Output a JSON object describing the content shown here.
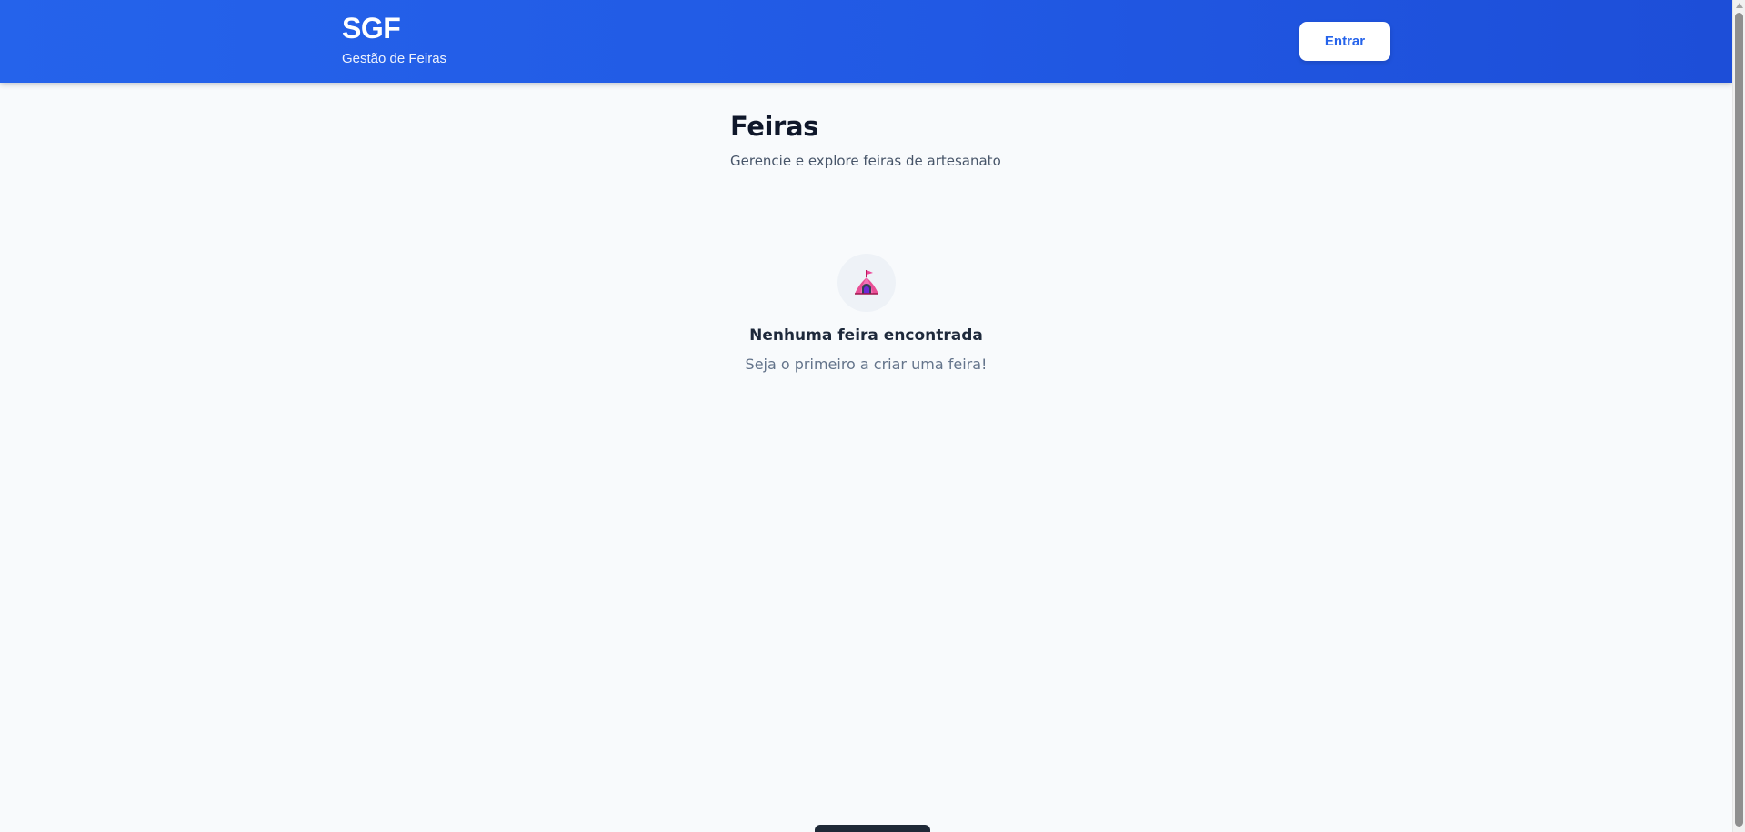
{
  "header": {
    "brand_title": "SGF",
    "brand_subtitle": "Gestão de Feiras",
    "login_label": "Entrar"
  },
  "main": {
    "title": "Feiras",
    "subtitle": "Gerencie e explore feiras de artesanato"
  },
  "empty_state": {
    "icon": "circus-tent-icon",
    "title": "Nenhuma feira encontrada",
    "message": "Seja o primeiro a criar uma feira!"
  },
  "colors": {
    "header_start": "#2563eb",
    "header_end": "#1d4ed8",
    "login_text": "#2563eb",
    "page_background": "#f8fafc",
    "title_text": "#0f172a",
    "muted_text": "#64748b",
    "tent_pink": "#e84f96",
    "tent_purple": "#6d28d9"
  }
}
